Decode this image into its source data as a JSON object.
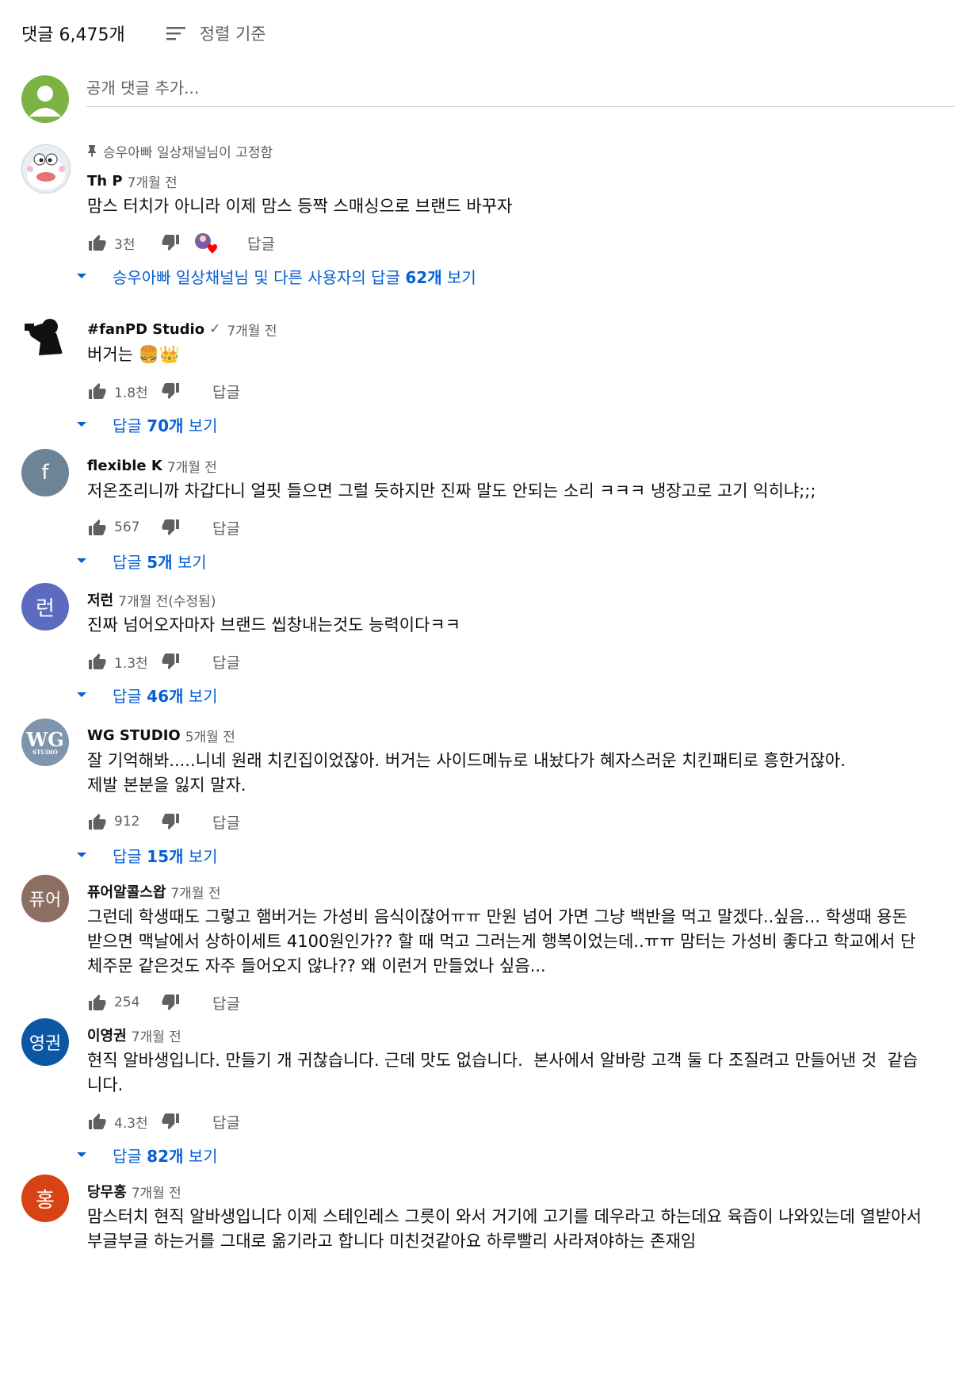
{
  "header": {
    "count_label": "댓글 6,475개",
    "sort_label": "정렬 기준"
  },
  "add_comment": {
    "placeholder": "공개 댓글 추가..."
  },
  "comments": [
    {
      "avatar": {
        "type": "image",
        "desc": "doraemon-avatar",
        "color": "#e8eef3"
      },
      "pinned_label": "승우아빠 일상채널님이 고정함",
      "author": "Th P",
      "time": "7개월 전",
      "text": "맘스 터치가 아니라 이제 맘스 등짝 스매싱으로 브랜드 바꾸자",
      "likes": "3천",
      "hearted": true,
      "reply_label": "답글",
      "replies_prefix": "승우아빠 일상채널님 및 다른 사용자의 답글 ",
      "replies_count": "62개",
      "replies_suffix": " 보기"
    },
    {
      "avatar": {
        "type": "image",
        "desc": "photographer-silhouette-avatar",
        "color": "#ffffff"
      },
      "author": "#fanPD Studio",
      "verified": "✓",
      "time": "7개월 전",
      "text": "버거는 🍔👑",
      "likes": "1.8천",
      "reply_label": "답글",
      "replies_prefix": "답글 ",
      "replies_count": "70개",
      "replies_suffix": " 보기"
    },
    {
      "avatar": {
        "type": "letter",
        "letter": "f",
        "color": "#6d8396"
      },
      "author": "flexible K",
      "time": "7개월 전",
      "text": "저온조리니까 차갑다니 얼핏 들으면 그럴 듯하지만 진짜 말도 안되는 소리 ㅋㅋㅋ 냉장고로 고기 익히냐;;;",
      "likes": "567",
      "reply_label": "답글",
      "replies_prefix": "답글 ",
      "replies_count": "5개",
      "replies_suffix": " 보기"
    },
    {
      "avatar": {
        "type": "letter",
        "letter": "런",
        "color": "#5c6bc0"
      },
      "author": "저런",
      "time": "7개월 전(수정됨)",
      "text": "진짜 넘어오자마자 브랜드 씹창내는것도 능력이다ㅋㅋ",
      "likes": "1.3천",
      "reply_label": "답글",
      "replies_prefix": "답글 ",
      "replies_count": "46개",
      "replies_suffix": " 보기"
    },
    {
      "avatar": {
        "type": "logo",
        "letter": "WG",
        "sub": "STUDIO",
        "color": "#7e95ad"
      },
      "author": "WG STUDIO",
      "time": "5개월 전",
      "text": "잘 기억해봐.....니네 원래 치킨집이었잖아. 버거는 사이드메뉴로 내놨다가 혜자스러운 치킨패티로 흥한거잖아.\n제발 본분을 잃지 말자.",
      "likes": "912",
      "reply_label": "답글",
      "replies_prefix": "답글 ",
      "replies_count": "15개",
      "replies_suffix": " 보기"
    },
    {
      "avatar": {
        "type": "letter",
        "letter": "퓨어",
        "color": "#8d6e63"
      },
      "author": "퓨어알콜스왑",
      "time": "7개월 전",
      "text": "그런데 학생때도 그렇고 햄버거는 가성비 음식이잖어ㅠㅠ 만원 넘어 가면 그냥 백반을 먹고 말겠다..싶음... 학생때 용돈 받으면 맥날에서 상하이세트 4100원인가?? 할 때 먹고 그러는게 행복이었는데..ㅠㅠ 맘터는 가성비 좋다고 학교에서 단체주문 같은것도 자주 들어오지 않나?? 왜 이런거 만들었나 싶음...",
      "likes": "254",
      "reply_label": "답글"
    },
    {
      "avatar": {
        "type": "letter",
        "letter": "영권",
        "color": "#0b57a4"
      },
      "author": "이영권",
      "time": "7개월 전",
      "text": "현직 알바생입니다. 만들기 개 귀찮습니다. 근데 맛도 없습니다.  본사에서 알바랑 고객 둘 다 조질려고 만들어낸 것  같습니다.",
      "likes": "4.3천",
      "reply_label": "답글",
      "replies_prefix": "답글 ",
      "replies_count": "82개",
      "replies_suffix": " 보기"
    },
    {
      "avatar": {
        "type": "letter",
        "letter": "홍",
        "color": "#d84315"
      },
      "author": "당무홍",
      "time": "7개월 전",
      "text": "맘스터치 현직 알바생입니다 이제 스테인레스 그릇이 와서 거기에 고기를 데우라고 하는데요 육즙이 나와있는데 열받아서 부글부글 하는거를 그대로 옮기라고 합니다 미친것같아요 하루빨리 사라져야하는 존재임"
    }
  ]
}
